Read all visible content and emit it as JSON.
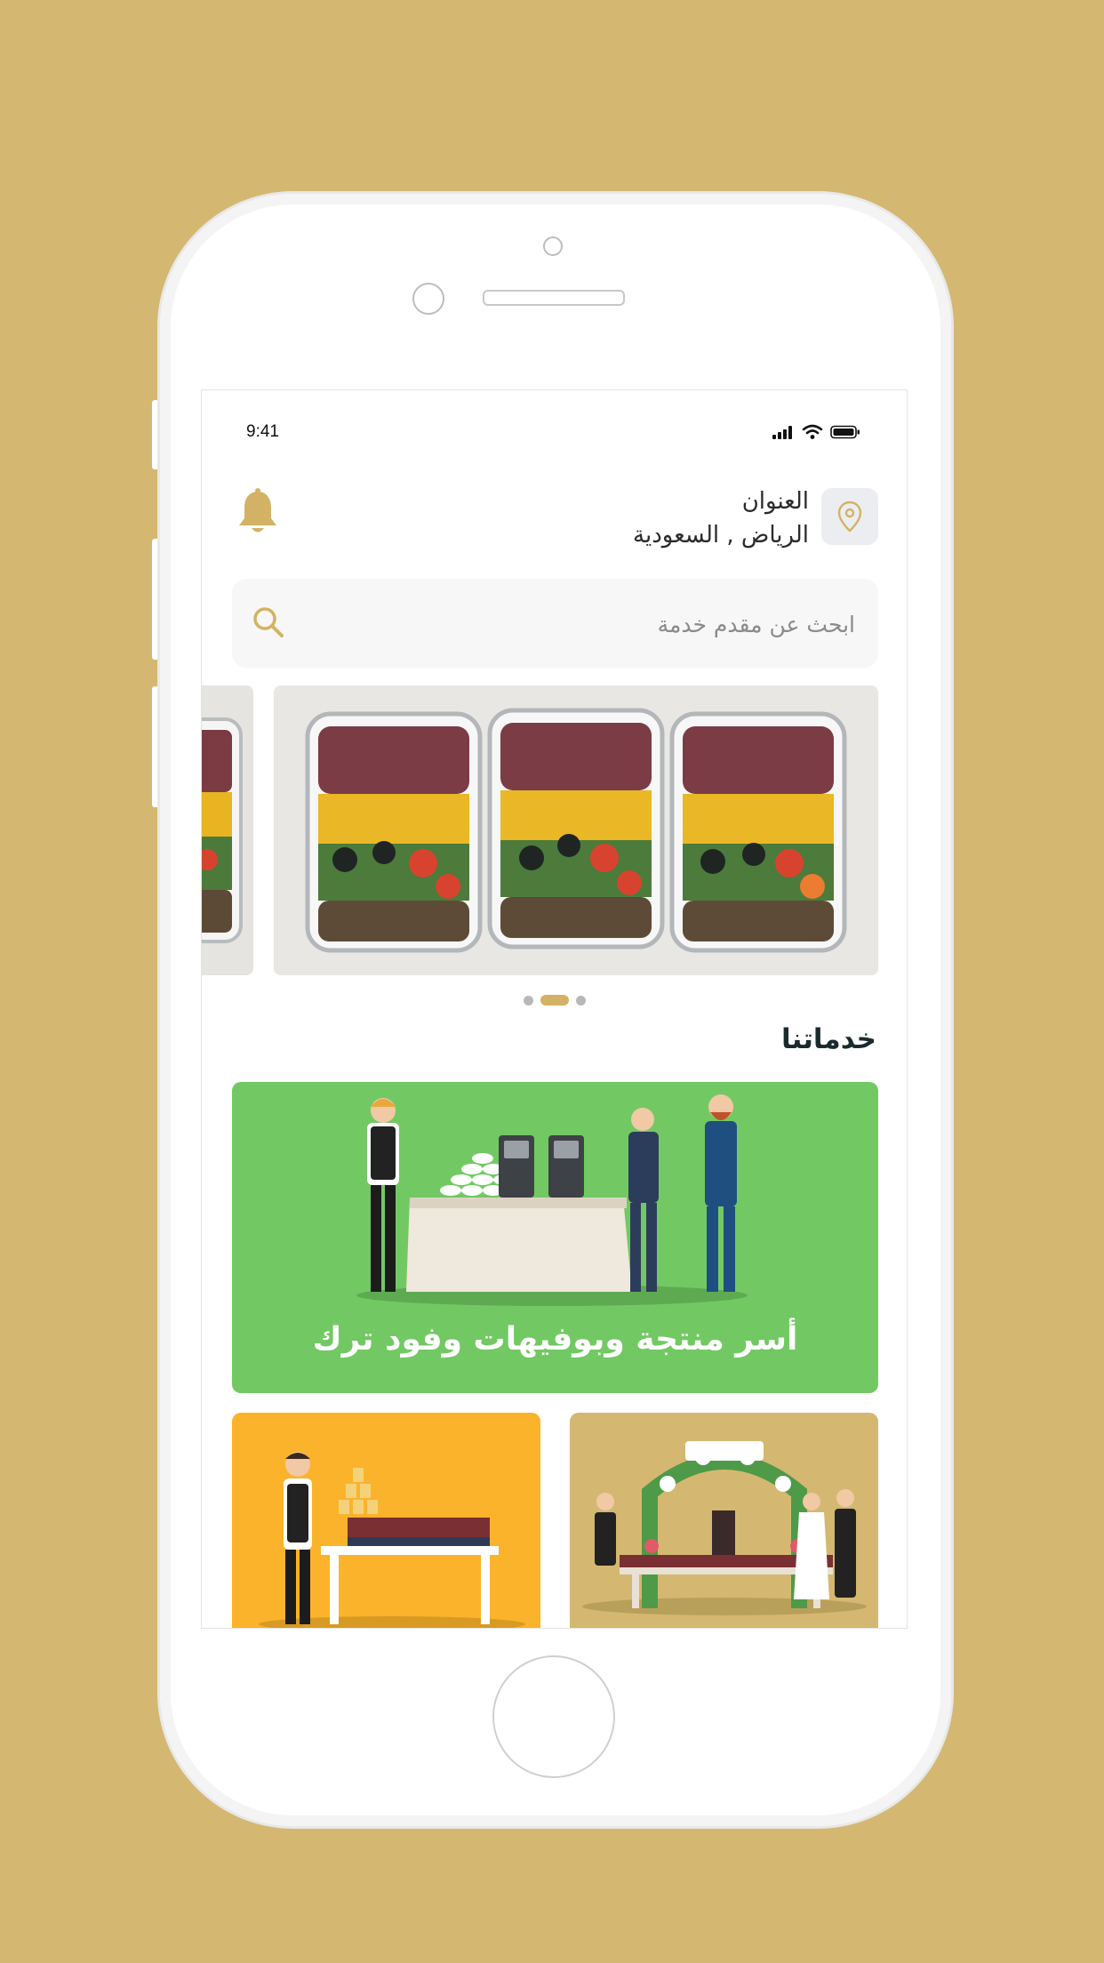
{
  "status_bar": {
    "time": "9:41"
  },
  "header": {
    "address_label": "العنوان",
    "address_value": "الرياض , السعودية"
  },
  "search": {
    "placeholder": "ابحث عن مقدم خدمة"
  },
  "carousel": {
    "active_index": 1,
    "count": 3
  },
  "services": {
    "title": "خدماتنا",
    "featured_label": "أسر منتجة وبوفيهات وفود ترك"
  },
  "colors": {
    "background": "#D4B871",
    "accent": "#D4B265",
    "featured_card": "#72C963",
    "card_orange": "#FBB32C"
  }
}
